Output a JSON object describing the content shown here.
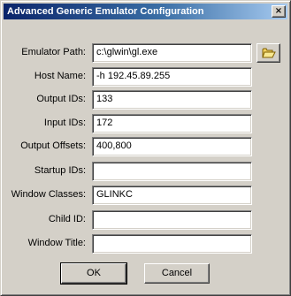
{
  "window": {
    "title": "Advanced Generic Emulator Configuration",
    "close_glyph": "×"
  },
  "fields": {
    "emulator_path": {
      "label": "Emulator Path:",
      "value": "c:\\glwin\\gl.exe"
    },
    "host_name": {
      "label": "Host Name:",
      "value": "-h 192.45.89.255"
    },
    "output_ids": {
      "label": "Output IDs:",
      "value": "133"
    },
    "input_ids": {
      "label": "Input IDs:",
      "value": "172"
    },
    "output_offsets": {
      "label": "Output Offsets:",
      "value": "400,800"
    },
    "startup_ids": {
      "label": "Startup IDs:",
      "value": ""
    },
    "window_classes": {
      "label": "Window Classes:",
      "value": "GLINKC"
    },
    "child_id": {
      "label": "Child ID:",
      "value": ""
    },
    "window_title": {
      "label": "Window Title:",
      "value": ""
    }
  },
  "browse_button": {
    "icon": "open-folder-icon"
  },
  "buttons": {
    "ok_label": "OK",
    "cancel_label": "Cancel"
  },
  "colors": {
    "title_start": "#0a246a",
    "title_end": "#a6caf0",
    "face": "#d4d0c8"
  }
}
